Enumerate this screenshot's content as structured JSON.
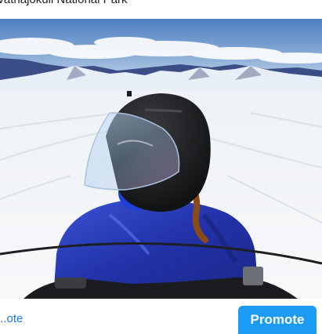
{
  "post": {
    "location_text": "Vatnajökull National Park",
    "photo_alt": "Person in black helmet on snowmobile"
  },
  "actions": {
    "left_link": "...ote",
    "promote_label": "Promote"
  },
  "colors": {
    "link": "#1877f2",
    "promote_bg": "#1b9bf4",
    "sky": "#5b86c4",
    "snow": "#f4f6f8",
    "jacket": "#2d3fc0"
  }
}
